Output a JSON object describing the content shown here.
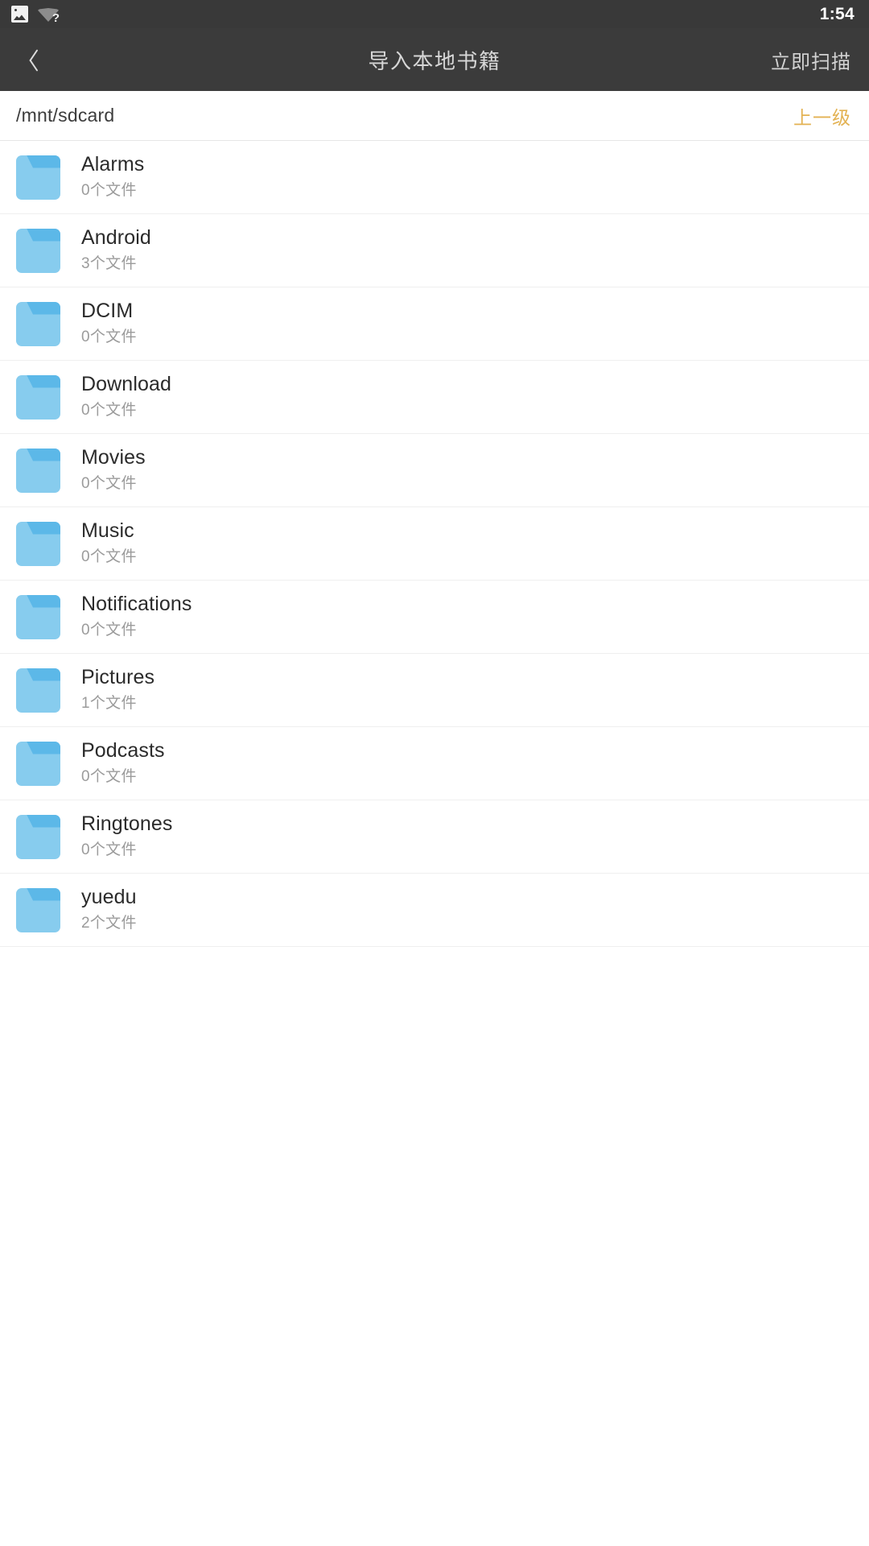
{
  "statusbar": {
    "time": "1:54",
    "icons": [
      {
        "name": "image-icon",
        "glyph": "image"
      },
      {
        "name": "wifi-unknown-icon",
        "glyph": "wifi",
        "badge": "?"
      }
    ]
  },
  "appbar": {
    "back_icon": "chevron-left-icon",
    "title": "导入本地书籍",
    "action_label": "立即扫描",
    "background_color": "#3b3b3b",
    "title_color": "#d7d7d7"
  },
  "pathbar": {
    "current_path": "/mnt/sdcard",
    "up_label": "上一级",
    "up_color": "#e3b253"
  },
  "filelist": {
    "item_icon": "folder-icon",
    "icon_color": "#87ccee",
    "icon_tab_color": "#5cb8e8",
    "items": [
      {
        "name": "Alarms",
        "subtitle": "0个文件"
      },
      {
        "name": "Android",
        "subtitle": "3个文件"
      },
      {
        "name": "DCIM",
        "subtitle": "0个文件"
      },
      {
        "name": "Download",
        "subtitle": "0个文件"
      },
      {
        "name": "Movies",
        "subtitle": "0个文件"
      },
      {
        "name": "Music",
        "subtitle": "0个文件"
      },
      {
        "name": "Notifications",
        "subtitle": "0个文件"
      },
      {
        "name": "Pictures",
        "subtitle": "1个文件"
      },
      {
        "name": "Podcasts",
        "subtitle": "0个文件"
      },
      {
        "name": "Ringtones",
        "subtitle": "0个文件"
      },
      {
        "name": "yuedu",
        "subtitle": "2个文件"
      }
    ]
  }
}
